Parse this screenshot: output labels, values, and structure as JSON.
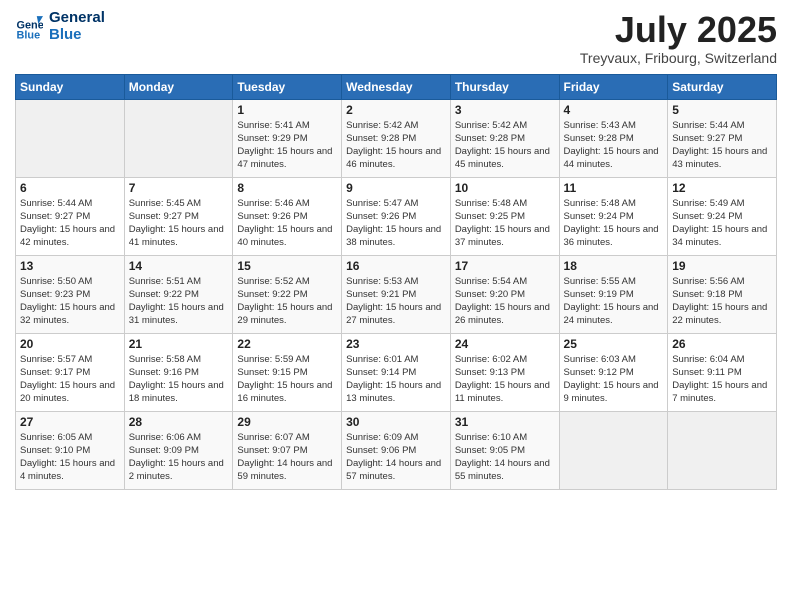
{
  "logo": {
    "line1": "General",
    "line2": "Blue"
  },
  "title": "July 2025",
  "subtitle": "Treyvaux, Fribourg, Switzerland",
  "days_of_week": [
    "Sunday",
    "Monday",
    "Tuesday",
    "Wednesday",
    "Thursday",
    "Friday",
    "Saturday"
  ],
  "weeks": [
    [
      {
        "day": "",
        "info": ""
      },
      {
        "day": "",
        "info": ""
      },
      {
        "day": "1",
        "info": "Sunrise: 5:41 AM\nSunset: 9:29 PM\nDaylight: 15 hours and 47 minutes."
      },
      {
        "day": "2",
        "info": "Sunrise: 5:42 AM\nSunset: 9:28 PM\nDaylight: 15 hours and 46 minutes."
      },
      {
        "day": "3",
        "info": "Sunrise: 5:42 AM\nSunset: 9:28 PM\nDaylight: 15 hours and 45 minutes."
      },
      {
        "day": "4",
        "info": "Sunrise: 5:43 AM\nSunset: 9:28 PM\nDaylight: 15 hours and 44 minutes."
      },
      {
        "day": "5",
        "info": "Sunrise: 5:44 AM\nSunset: 9:27 PM\nDaylight: 15 hours and 43 minutes."
      }
    ],
    [
      {
        "day": "6",
        "info": "Sunrise: 5:44 AM\nSunset: 9:27 PM\nDaylight: 15 hours and 42 minutes."
      },
      {
        "day": "7",
        "info": "Sunrise: 5:45 AM\nSunset: 9:27 PM\nDaylight: 15 hours and 41 minutes."
      },
      {
        "day": "8",
        "info": "Sunrise: 5:46 AM\nSunset: 9:26 PM\nDaylight: 15 hours and 40 minutes."
      },
      {
        "day": "9",
        "info": "Sunrise: 5:47 AM\nSunset: 9:26 PM\nDaylight: 15 hours and 38 minutes."
      },
      {
        "day": "10",
        "info": "Sunrise: 5:48 AM\nSunset: 9:25 PM\nDaylight: 15 hours and 37 minutes."
      },
      {
        "day": "11",
        "info": "Sunrise: 5:48 AM\nSunset: 9:24 PM\nDaylight: 15 hours and 36 minutes."
      },
      {
        "day": "12",
        "info": "Sunrise: 5:49 AM\nSunset: 9:24 PM\nDaylight: 15 hours and 34 minutes."
      }
    ],
    [
      {
        "day": "13",
        "info": "Sunrise: 5:50 AM\nSunset: 9:23 PM\nDaylight: 15 hours and 32 minutes."
      },
      {
        "day": "14",
        "info": "Sunrise: 5:51 AM\nSunset: 9:22 PM\nDaylight: 15 hours and 31 minutes."
      },
      {
        "day": "15",
        "info": "Sunrise: 5:52 AM\nSunset: 9:22 PM\nDaylight: 15 hours and 29 minutes."
      },
      {
        "day": "16",
        "info": "Sunrise: 5:53 AM\nSunset: 9:21 PM\nDaylight: 15 hours and 27 minutes."
      },
      {
        "day": "17",
        "info": "Sunrise: 5:54 AM\nSunset: 9:20 PM\nDaylight: 15 hours and 26 minutes."
      },
      {
        "day": "18",
        "info": "Sunrise: 5:55 AM\nSunset: 9:19 PM\nDaylight: 15 hours and 24 minutes."
      },
      {
        "day": "19",
        "info": "Sunrise: 5:56 AM\nSunset: 9:18 PM\nDaylight: 15 hours and 22 minutes."
      }
    ],
    [
      {
        "day": "20",
        "info": "Sunrise: 5:57 AM\nSunset: 9:17 PM\nDaylight: 15 hours and 20 minutes."
      },
      {
        "day": "21",
        "info": "Sunrise: 5:58 AM\nSunset: 9:16 PM\nDaylight: 15 hours and 18 minutes."
      },
      {
        "day": "22",
        "info": "Sunrise: 5:59 AM\nSunset: 9:15 PM\nDaylight: 15 hours and 16 minutes."
      },
      {
        "day": "23",
        "info": "Sunrise: 6:01 AM\nSunset: 9:14 PM\nDaylight: 15 hours and 13 minutes."
      },
      {
        "day": "24",
        "info": "Sunrise: 6:02 AM\nSunset: 9:13 PM\nDaylight: 15 hours and 11 minutes."
      },
      {
        "day": "25",
        "info": "Sunrise: 6:03 AM\nSunset: 9:12 PM\nDaylight: 15 hours and 9 minutes."
      },
      {
        "day": "26",
        "info": "Sunrise: 6:04 AM\nSunset: 9:11 PM\nDaylight: 15 hours and 7 minutes."
      }
    ],
    [
      {
        "day": "27",
        "info": "Sunrise: 6:05 AM\nSunset: 9:10 PM\nDaylight: 15 hours and 4 minutes."
      },
      {
        "day": "28",
        "info": "Sunrise: 6:06 AM\nSunset: 9:09 PM\nDaylight: 15 hours and 2 minutes."
      },
      {
        "day": "29",
        "info": "Sunrise: 6:07 AM\nSunset: 9:07 PM\nDaylight: 14 hours and 59 minutes."
      },
      {
        "day": "30",
        "info": "Sunrise: 6:09 AM\nSunset: 9:06 PM\nDaylight: 14 hours and 57 minutes."
      },
      {
        "day": "31",
        "info": "Sunrise: 6:10 AM\nSunset: 9:05 PM\nDaylight: 14 hours and 55 minutes."
      },
      {
        "day": "",
        "info": ""
      },
      {
        "day": "",
        "info": ""
      }
    ]
  ]
}
